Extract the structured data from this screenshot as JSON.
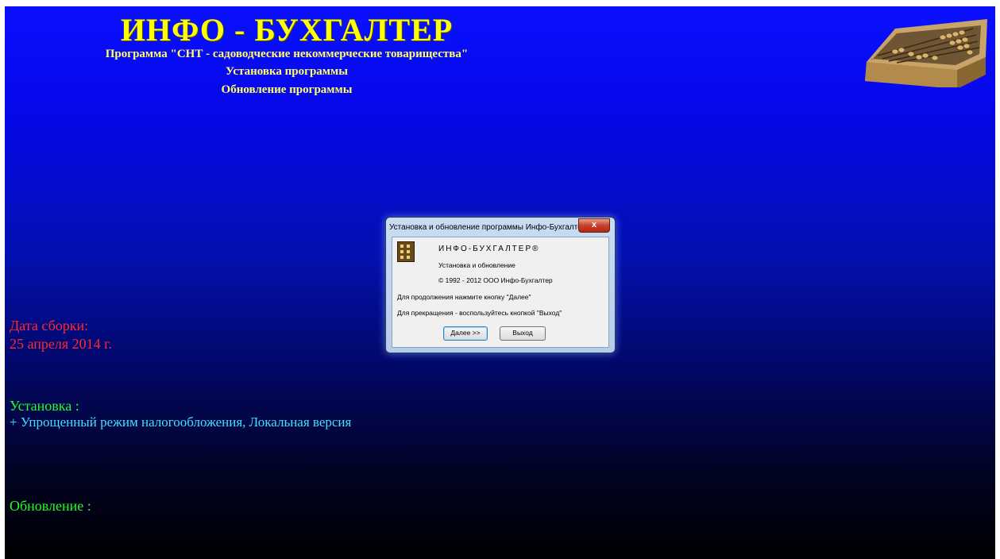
{
  "header": {
    "title": "ИНФО - БУХГАЛТЕР",
    "subtitle": "Программа \"СНТ - садоводческие некоммерческие товарищества\"",
    "links": [
      "Установка программы",
      "Обновление программы"
    ]
  },
  "info": {
    "build_label": "Дата сборки:",
    "build_date": "25 апреля 2014 г.",
    "install_label": "Установка :",
    "install_item": "+ Упрощенный режим налогообложения, Локальная версия",
    "update_label": "Обновление :"
  },
  "dialog": {
    "title": "Установка и обновление программы Инфо-Бухгалтер",
    "close": "x",
    "brand": "ИНФО-БУХГАЛТЕР®",
    "line1": "Установка и обновление",
    "line2": "© 1992 - 2012 ООО Инфо-Бухгалтер",
    "line3": "Для продолжения нажмите кнопку \"Далее\"",
    "line4": "Для прекращения - воспользуйтесь кнопкой \"Выход\"",
    "next_button": "Далее >>",
    "exit_button": "Выход"
  },
  "colors": {
    "background_top": "#0a10ff",
    "background_bottom": "#000000",
    "title": "#ffff00",
    "build": "#ff2a2a",
    "section_label": "#22ff22",
    "install_item": "#40e0ff"
  },
  "icons": [
    "abacus-image",
    "app-icon",
    "close-icon"
  ]
}
